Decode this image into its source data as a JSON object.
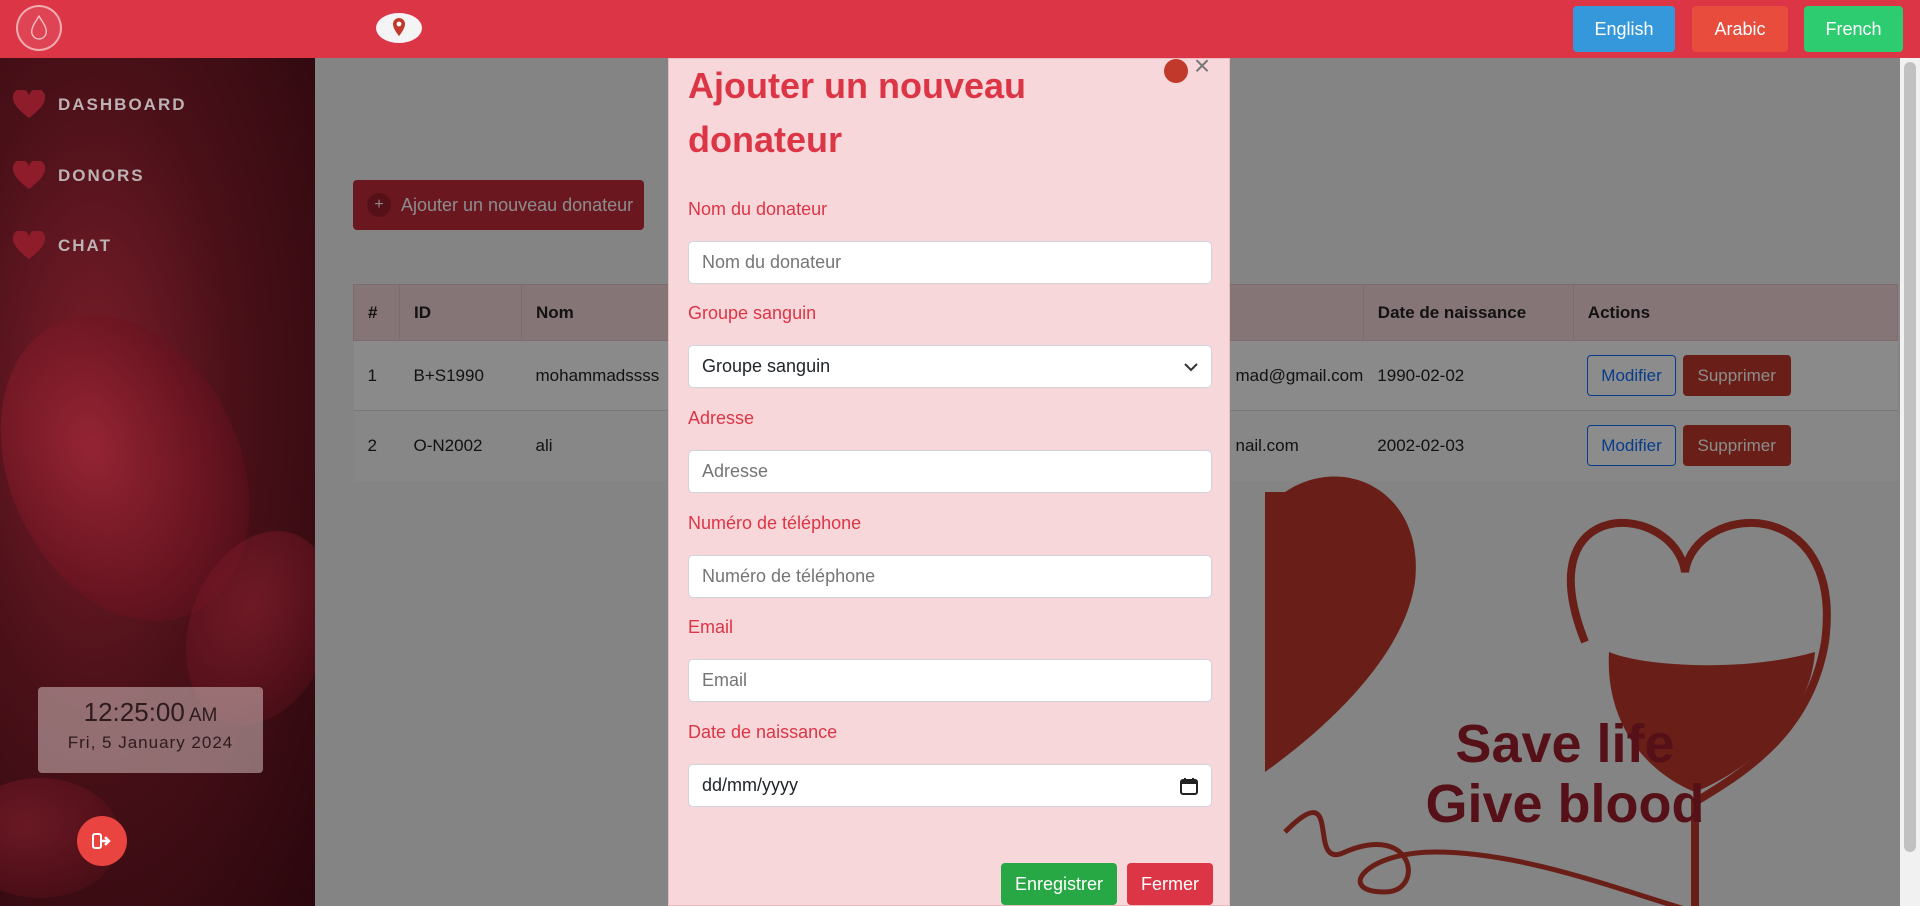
{
  "topbar": {
    "languages": [
      "English",
      "Arabic",
      "French"
    ],
    "colors": {
      "bar": "#dc3545",
      "english": "#3498db",
      "arabic": "#e74c3c",
      "french": "#2ecc71"
    }
  },
  "sidebar": {
    "items": [
      {
        "label": "DASHBOARD",
        "icon": "heart-icon"
      },
      {
        "label": "DONORS",
        "icon": "heart-icon"
      },
      {
        "label": "CHAT",
        "icon": "heart-icon"
      }
    ],
    "clock": {
      "time": "12:25:00",
      "ampm": "AM",
      "date": "Fri, 5 January 2024"
    },
    "logout_icon": "logout-icon"
  },
  "main": {
    "add_button": "Ajouter un nouveau donateur",
    "table": {
      "headers": [
        "#",
        "ID",
        "Nom",
        "",
        "Date de naissance",
        "Actions"
      ],
      "rows": [
        {
          "num": "1",
          "id": "B+S1990",
          "nom": "mohammadssss",
          "email": "mad@gmail.com",
          "dob": "1990-02-02"
        },
        {
          "num": "2",
          "id": "O-N2002",
          "nom": "ali",
          "email": "nail.com",
          "dob": "2002-02-03"
        }
      ],
      "edit_label": "Modifier",
      "delete_label": "Supprimer"
    },
    "poster": {
      "line1": "Save life",
      "line2": "Give blood"
    }
  },
  "modal": {
    "title": "Ajouter un nouveau donateur",
    "fields": {
      "name": {
        "label": "Nom du donateur",
        "placeholder": "Nom du donateur"
      },
      "blood": {
        "label": "Groupe sanguin",
        "value": "Groupe sanguin"
      },
      "address": {
        "label": "Adresse",
        "placeholder": "Adresse"
      },
      "phone": {
        "label": "Numéro de téléphone",
        "placeholder": "Numéro de téléphone"
      },
      "email": {
        "label": "Email",
        "placeholder": "Email"
      },
      "dob": {
        "label": "Date de naissance",
        "placeholder": "dd/mm/yyyy"
      }
    },
    "save_label": "Enregistrer",
    "close_label": "Fermer"
  }
}
